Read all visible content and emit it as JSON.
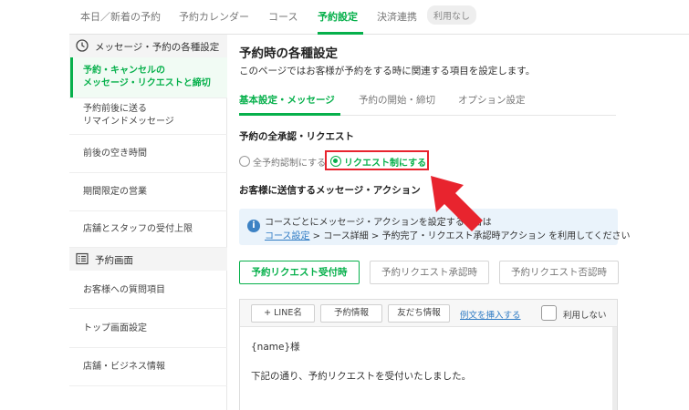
{
  "topnav": {
    "tabs": [
      {
        "label": "本日／新着の予約"
      },
      {
        "label": "予約カレンダー"
      },
      {
        "label": "コース"
      },
      {
        "label": "予約設定"
      },
      {
        "label": "決済連携"
      }
    ],
    "active_index": 3,
    "badge": "利用なし"
  },
  "sidebar": {
    "section1": {
      "label": "メッセージ・予約の各種設定",
      "icon": "clock-icon"
    },
    "items1": [
      {
        "line1": "予約・キャンセルの",
        "line2": "メッセージ・リクエストと締切"
      },
      {
        "line1": "予約前後に送る",
        "line2": "リマインドメッセージ"
      },
      {
        "line1": "前後の空き時間"
      },
      {
        "line1": "期間限定の営業"
      },
      {
        "line1": "店舗とスタッフの受付上限"
      }
    ],
    "section2": {
      "label": "予約画面",
      "icon": "list-icon"
    },
    "items2": [
      {
        "line1": "お客様への質問項目"
      },
      {
        "line1": "トップ画面設定"
      },
      {
        "line1": "店舗・ビジネス情報"
      }
    ]
  },
  "main": {
    "title": "予約時の各種設定",
    "description": "このページではお客様が予約をする時に関連する項目を設定します。",
    "subtabs": [
      {
        "label": "基本設定・メッセージ"
      },
      {
        "label": "予約の開始・締切"
      },
      {
        "label": "オプション設定"
      }
    ],
    "approval": {
      "title": "予約の全承認・リクエスト",
      "options": [
        {
          "label": "全予約認制にする",
          "checked": false
        },
        {
          "label": "リクエスト制にする",
          "checked": true
        }
      ]
    },
    "message_section_title": "お客様に送信するメッセージ・アクション",
    "info": {
      "line1": "コースごとにメッセージ・アクションを設定する場合は",
      "link": "コース設定",
      "line2_rest": " > コース詳細 > 予約完了・リクエスト承認時アクション を利用してください"
    },
    "message_tabs": [
      {
        "label": "予約リクエスト受付時",
        "active": true
      },
      {
        "label": "予約リクエスト承認時",
        "active": false
      },
      {
        "label": "予約リクエスト否認時",
        "active": false
      }
    ],
    "editor": {
      "buttons": [
        {
          "label": "+ LINE名"
        },
        {
          "label": "予約情報"
        },
        {
          "label": "友だち情報"
        }
      ],
      "insert_link": "例文を挿入する",
      "unused_label": "利用しない",
      "lines": [
        "{name}様",
        "下記の通り、予約リクエストを受付いたしました。"
      ]
    }
  },
  "colors": {
    "accent": "#06b04b",
    "highlight": "#e8242e",
    "info_bg": "#eaf3fb",
    "link": "#2f7bc4"
  }
}
